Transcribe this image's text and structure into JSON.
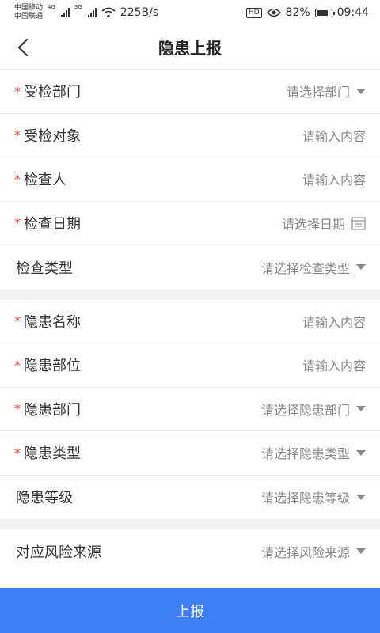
{
  "status_bar": {
    "carrier_1": "中国移动",
    "carrier_2": "中国联通",
    "net_1": "4G",
    "net_2": "3G",
    "speed": "225B/s",
    "hd": "HD",
    "battery": "82%",
    "time": "09:44",
    "battery_level": 0.82
  },
  "header": {
    "title": "隐患上报",
    "back_icon": "chevron-left-icon"
  },
  "sections": [
    [
      {
        "label": "受检部门",
        "required": true,
        "placeholder": "请选择部门",
        "control": "dropdown"
      },
      {
        "label": "受检对象",
        "required": true,
        "placeholder": "请输入内容",
        "control": "input"
      },
      {
        "label": "检查人",
        "required": true,
        "placeholder": "请输入内容",
        "control": "input"
      },
      {
        "label": "检查日期",
        "required": true,
        "placeholder": "请选择日期",
        "control": "date"
      },
      {
        "label": "检查类型",
        "required": false,
        "placeholder": "请选择检查类型",
        "control": "dropdown"
      }
    ],
    [
      {
        "label": "隐患名称",
        "required": true,
        "placeholder": "请输入内容",
        "control": "input"
      },
      {
        "label": "隐患部位",
        "required": true,
        "placeholder": "请输入内容",
        "control": "input"
      },
      {
        "label": "隐患部门",
        "required": true,
        "placeholder": "请选择隐患部门",
        "control": "dropdown"
      },
      {
        "label": "隐患类型",
        "required": true,
        "placeholder": "请选择隐患类型",
        "control": "dropdown"
      },
      {
        "label": "隐患等级",
        "required": false,
        "placeholder": "请选择隐患等级",
        "control": "dropdown"
      }
    ],
    [
      {
        "label": "对应风险来源",
        "required": false,
        "placeholder": "请选择风险来源",
        "control": "dropdown"
      }
    ]
  ],
  "required_mark": "*",
  "submit_label": "上报",
  "colors": {
    "accent": "#3f7ff5",
    "required": "#e53935",
    "placeholder": "#888888",
    "section_gap": "#f2f2f2"
  }
}
